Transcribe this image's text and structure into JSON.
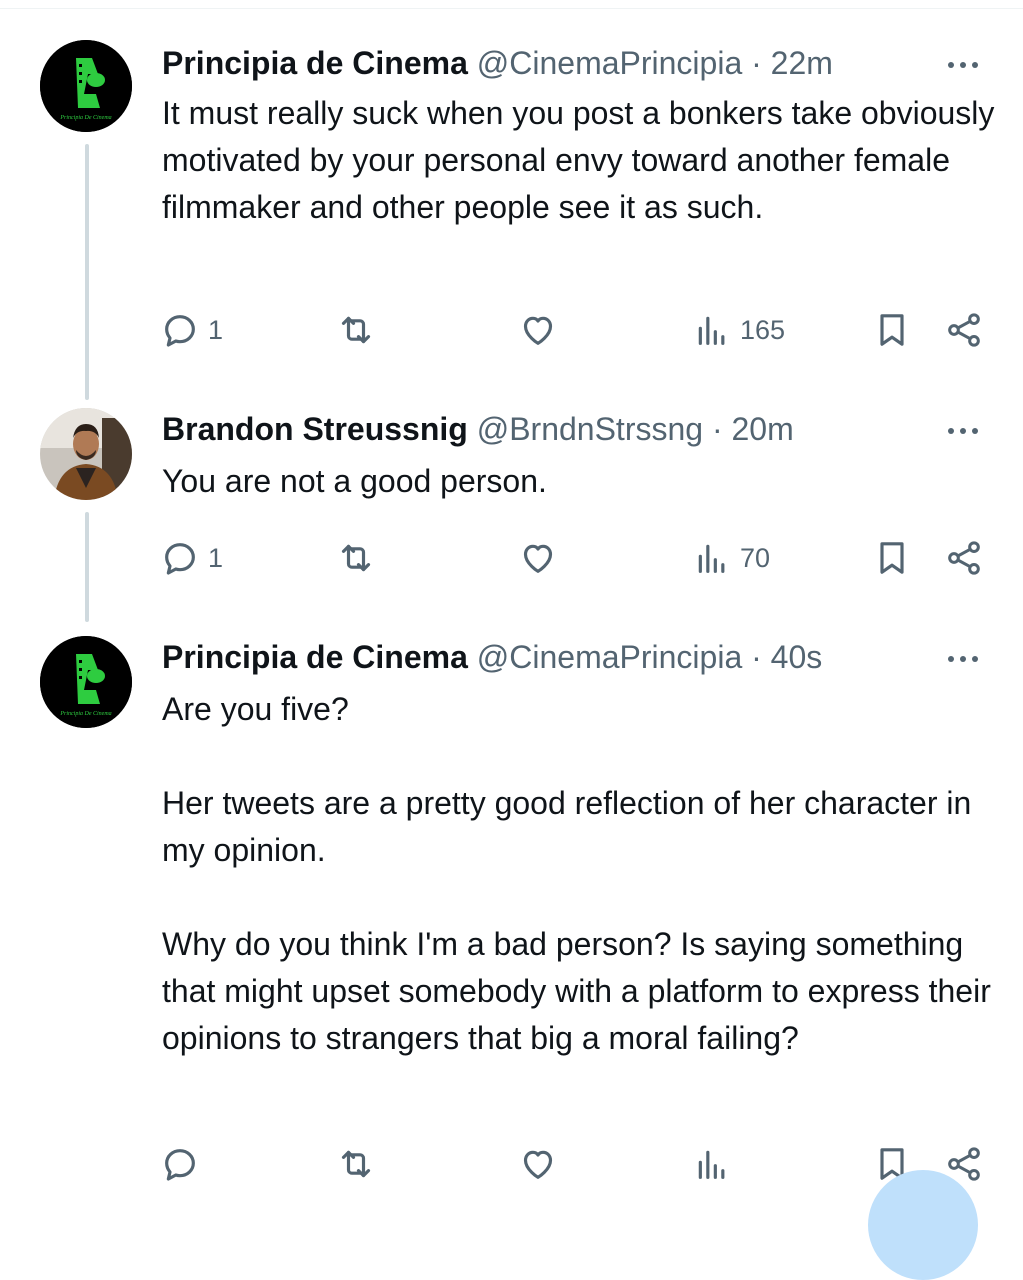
{
  "tweets": [
    {
      "avatar": "principia-de-cinema-logo",
      "avatar_text": "Principia De Cinema",
      "name": "Principia de Cinema",
      "handle": "@CinemaPrincipia",
      "time": "· 22m",
      "text": "It must really suck when you post a bonkers take obviously motivated by your personal envy toward another female filmmaker and other people see it as such.",
      "replies": "1",
      "retweets": "",
      "likes": "",
      "views": "165"
    },
    {
      "avatar": "brandon-streussnig-photo",
      "name": "Brandon Streussnig",
      "handle": "@BrndnStrssng",
      "time": "· 20m",
      "text": "You are not a good person.",
      "replies": "1",
      "retweets": "",
      "likes": "",
      "views": "70"
    },
    {
      "avatar": "principia-de-cinema-logo",
      "avatar_text": "Principia De Cinema",
      "name": "Principia de Cinema",
      "handle": "@CinemaPrincipia",
      "time": "· 40s",
      "text": "Are you five?\n\nHer tweets are a pretty good reflection of her character in my opinion.\n\nWhy do you think I'm a bad person? Is saying something that might upset somebody with a platform to express their opinions to strangers that big a moral failing?",
      "replies": "",
      "retweets": "",
      "likes": "",
      "views": ""
    }
  ],
  "icons": {
    "reply": "reply-icon",
    "retweet": "retweet-icon",
    "like": "heart-icon",
    "views": "views-icon",
    "bookmark": "bookmark-icon",
    "share": "share-icon",
    "more": "more-options-icon"
  },
  "colors": {
    "text": "#0f1419",
    "muted": "#536471",
    "thread_line": "#cfd9de",
    "logo_green": "#2ecc40",
    "fab": "#bfe0fb"
  }
}
